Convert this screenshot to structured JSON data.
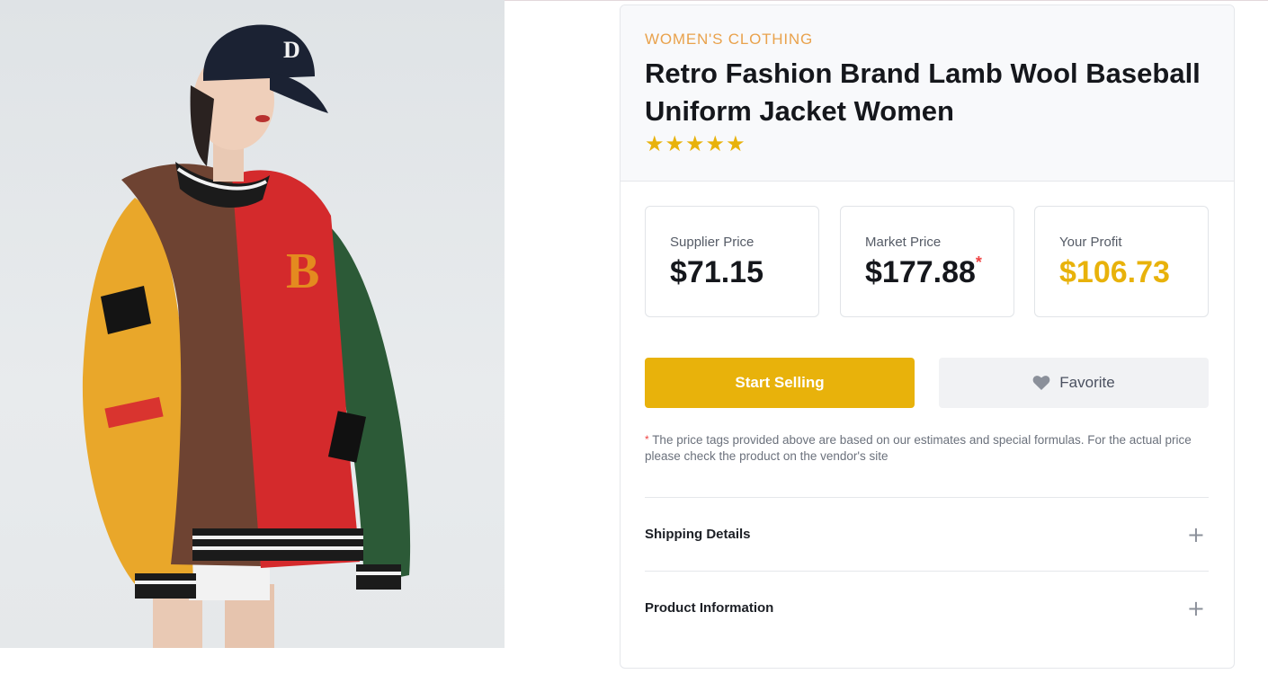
{
  "product": {
    "category": "WOMEN'S CLOTHING",
    "title": "Retro Fashion Brand Lamb Wool Baseball Uniform Jacket Women",
    "rating": 5,
    "stars": [
      "★",
      "★",
      "★",
      "★",
      "★"
    ]
  },
  "prices": {
    "supplier": {
      "label": "Supplier Price",
      "value": "$71.15"
    },
    "market": {
      "label": "Market Price",
      "value": "$177.88",
      "marker": "*"
    },
    "profit": {
      "label": "Your Profit",
      "value": "$106.73"
    }
  },
  "actions": {
    "sell_label": "Start Selling",
    "favorite_label": "Favorite",
    "favorite_icon": "heart-icon"
  },
  "note": {
    "marker": "*",
    "text": "The price tags provided above are based on our estimates and special formulas. For the actual price please check the product on the vendor's site"
  },
  "accordion": [
    {
      "label": "Shipping Details",
      "icon": "plus-icon",
      "symbol": "+"
    },
    {
      "label": "Product Information",
      "icon": "plus-icon",
      "symbol": "+"
    }
  ],
  "colors": {
    "accent": "#e8b20b",
    "category": "#e9a24c",
    "asterisk": "#ef4444"
  }
}
